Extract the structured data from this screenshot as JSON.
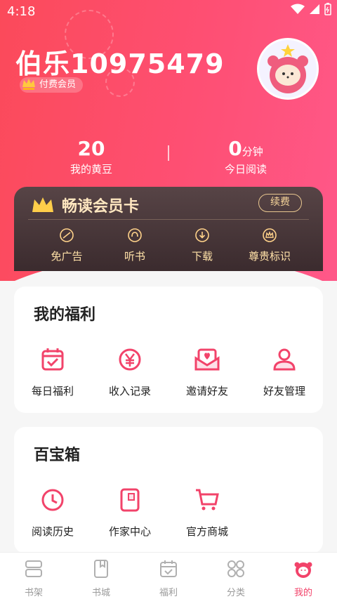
{
  "status_bar": {
    "time": "4:18"
  },
  "profile": {
    "username": "伯乐10975479",
    "vip_badge": "付费会员"
  },
  "stats": {
    "beans_value": "20",
    "beans_label": "我的黄豆",
    "reading_value": "0",
    "reading_unit": "分钟",
    "reading_label": "今日阅读"
  },
  "vip_card": {
    "title": "畅读会员卡",
    "renew_label": "续费",
    "features": [
      {
        "label": "免广告",
        "icon": "no-ads-icon"
      },
      {
        "label": "听书",
        "icon": "headphones-icon"
      },
      {
        "label": "下载",
        "icon": "download-icon"
      },
      {
        "label": "尊贵标识",
        "icon": "crown-badge-icon"
      }
    ]
  },
  "welfare": {
    "title": "我的福利",
    "items": [
      {
        "label": "每日福利",
        "icon": "calendar-check-icon"
      },
      {
        "label": "收入记录",
        "icon": "yen-coin-icon"
      },
      {
        "label": "邀请好友",
        "icon": "invite-letter-icon"
      },
      {
        "label": "好友管理",
        "icon": "person-icon"
      }
    ]
  },
  "toolbox": {
    "title": "百宝箱",
    "items": [
      {
        "label": "阅读历史",
        "icon": "clock-icon"
      },
      {
        "label": "作家中心",
        "icon": "writer-book-icon"
      },
      {
        "label": "官方商城",
        "icon": "shopping-cart-icon"
      }
    ]
  },
  "tabbar": {
    "tabs": [
      {
        "label": "书架",
        "icon": "bookshelf-icon"
      },
      {
        "label": "书城",
        "icon": "bookstore-icon"
      },
      {
        "label": "福利",
        "icon": "calendar-icon"
      },
      {
        "label": "分类",
        "icon": "grid-icon"
      },
      {
        "label": "我的",
        "icon": "mascot-icon"
      }
    ],
    "active_index": 4
  },
  "colors": {
    "accent": "#f2436a",
    "hero_start": "#fb4a5a",
    "hero_end": "#ff5889",
    "vip_gold": "#ffe1a8"
  }
}
